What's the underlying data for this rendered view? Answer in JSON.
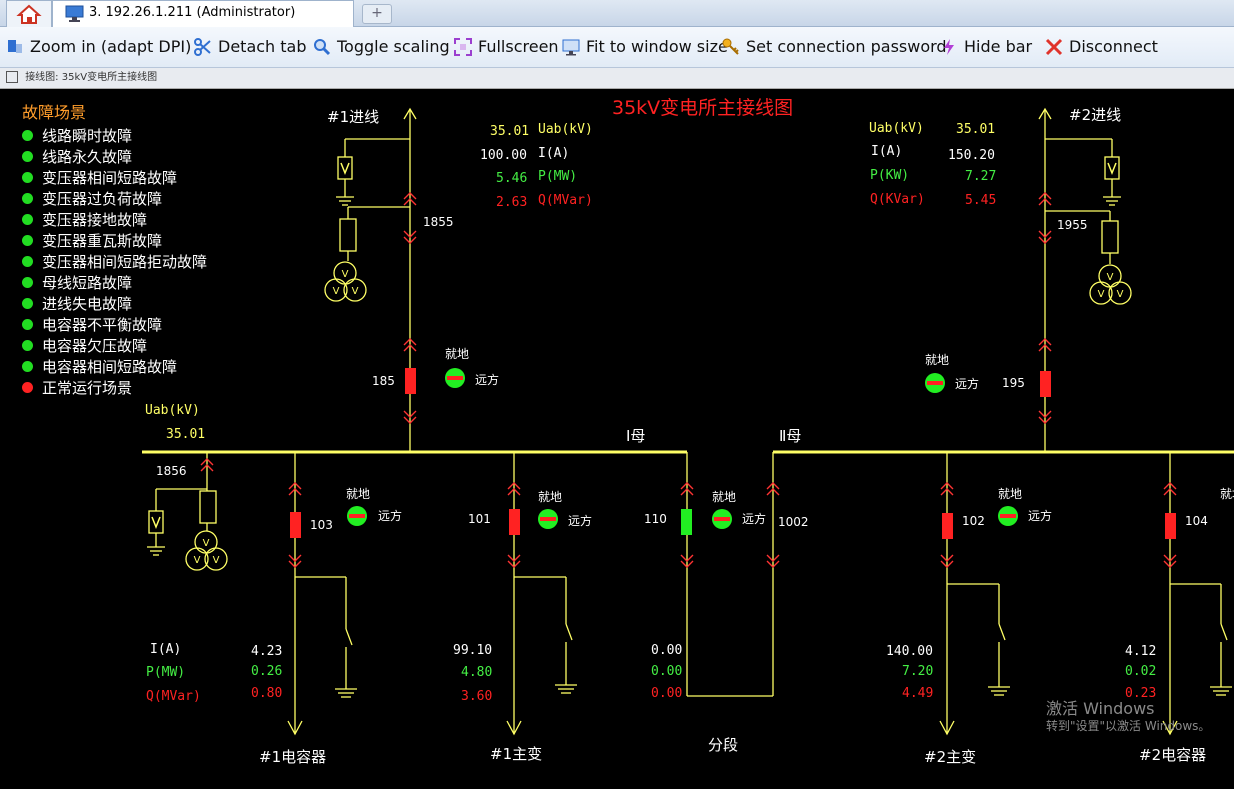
{
  "window": {
    "session_tab": "3. 192.26.1.211 (Administrator)",
    "add_tab_label": "+"
  },
  "toolbar": {
    "zoom": "Zoom in (adapt DPI)",
    "detach": "Detach tab",
    "toggle": "Toggle scaling",
    "fullscreen": "Fullscreen",
    "fit": "Fit to window size",
    "password": "Set connection password",
    "hide": "Hide bar",
    "disconnect": "Disconnect"
  },
  "subwindow_title": "接线图: 35kV变电所主接线图",
  "diagram": {
    "title": "35kV变电所主接线图",
    "fault_title": "故障场景",
    "faults": [
      {
        "label": "线路瞬时故障",
        "color": "#22dd22"
      },
      {
        "label": "线路永久故障",
        "color": "#22dd22"
      },
      {
        "label": "变压器相间短路故障",
        "color": "#22dd22"
      },
      {
        "label": "变压器过负荷故障",
        "color": "#22dd22"
      },
      {
        "label": "变压器接地故障",
        "color": "#22dd22"
      },
      {
        "label": "变压器重瓦斯故障",
        "color": "#22dd22"
      },
      {
        "label": "变压器相间短路拒动故障",
        "color": "#22dd22"
      },
      {
        "label": "母线短路故障",
        "color": "#22dd22"
      },
      {
        "label": "进线失电故障",
        "color": "#22dd22"
      },
      {
        "label": "电容器不平衡故障",
        "color": "#22dd22"
      },
      {
        "label": "电容器欠压故障",
        "color": "#22dd22"
      },
      {
        "label": "电容器相间短路故障",
        "color": "#22dd22"
      },
      {
        "label": "正常运行场景",
        "color": "#ff2222"
      }
    ],
    "incoming1": {
      "name": "#1进线",
      "switch1": "1855",
      "breaker": "185",
      "uab_label": "Uab(kV)",
      "uab": "35.01",
      "i_label": "I(A)",
      "i": "100.00",
      "p_label": "P(MW)",
      "p": "5.46",
      "q_label": "Q(MVar)",
      "q": "2.63"
    },
    "incoming2": {
      "name": "#2进线",
      "switch1": "1955",
      "breaker": "195",
      "uab_label": "Uab(kV)",
      "uab": "35.01",
      "i_label": "I(A)",
      "i": "150.20",
      "p_label": "P(KW)",
      "p": "7.27",
      "q_label": "Q(KVar)",
      "q": "5.45"
    },
    "bus1": {
      "name": "Ⅰ母",
      "uab_label": "Uab(kV)",
      "uab": "35.01",
      "pt_switch": "1856"
    },
    "bus2": {
      "name": "Ⅱ母"
    },
    "local_label": "就地",
    "remote_label": "远方",
    "feeders": {
      "f103": {
        "breaker": "103",
        "name": "#1电容器",
        "i_label": "I(A)",
        "p_label": "P(MW)",
        "q_label": "Q(MVar)",
        "i": "4.23",
        "p": "0.26",
        "q": "0.80"
      },
      "f101": {
        "breaker": "101",
        "name": "#1主变",
        "i": "99.10",
        "p": "4.80",
        "q": "3.60"
      },
      "f110": {
        "breaker": "110",
        "tie_switch": "1002",
        "name": "分段",
        "i": "0.00",
        "p": "0.00",
        "q": "0.00"
      },
      "f102": {
        "breaker": "102",
        "name": "#2主变",
        "i": "140.00",
        "p": "7.20",
        "q": "4.49"
      },
      "f104": {
        "breaker": "104",
        "name": "#2电容器",
        "i": "4.12",
        "p": "0.02",
        "q": "0.23"
      }
    },
    "watermark": {
      "line1": "激活 Windows",
      "line2": "转到\"设置\"以激活 Windows。"
    }
  }
}
